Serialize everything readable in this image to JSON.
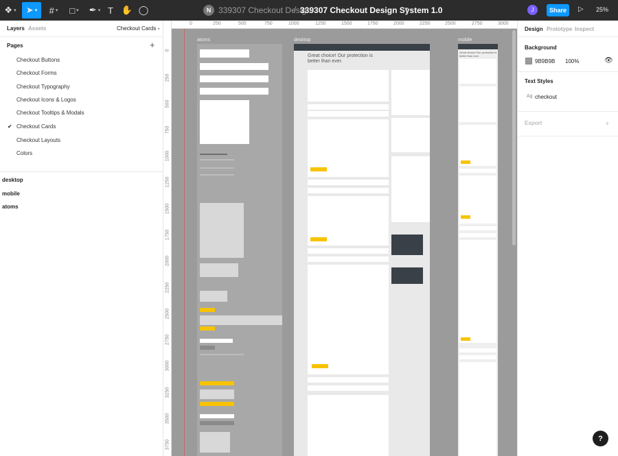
{
  "toolbar": {
    "file_avatar": "N",
    "file_name": "339307 Checkout Desig...",
    "separator": "/",
    "page_name": "339307 Checkout Design System 1.0",
    "user_initial": "J",
    "share_label": "Share",
    "zoom_label": "25%"
  },
  "left_panel": {
    "tabs": [
      "Layers",
      "Assets"
    ],
    "current_page": "Checkout Cards",
    "pages_heading": "Pages",
    "pages": [
      "Checkout Buttons",
      "Checkout Forms",
      "Checkout Typography",
      "Checkout Icons & Logos",
      "Checkout Tooltips & Modals",
      "Checkout Cards",
      "Checkout Layouts",
      "Colors"
    ],
    "selected_page_index": 5,
    "layers": [
      "desktop",
      "mobile",
      "atoms"
    ]
  },
  "canvas": {
    "ruler_x": [
      "0",
      "250",
      "500",
      "750",
      "1000",
      "1250",
      "1500",
      "1750",
      "2000",
      "2250",
      "2500",
      "2750",
      "3000"
    ],
    "ruler_y": [
      "0",
      "250",
      "500",
      "750",
      "1000",
      "1250",
      "1500",
      "1750",
      "2000",
      "2250",
      "2500",
      "2750",
      "3000",
      "3250",
      "3500",
      "3750"
    ],
    "frames": [
      "atoms",
      "desktop",
      "mobile"
    ],
    "desktop_hero": "Great choice! Our protection is better than ever.",
    "mobile_hero": "Great choice! Our protection is better than ever."
  },
  "right_panel": {
    "tabs": [
      "Design",
      "Prototype",
      "Inspect"
    ],
    "background_heading": "Background",
    "background_hex": "9B9B9B",
    "background_opacity": "100%",
    "background_color": "#9b9b9b",
    "text_styles_heading": "Text Styles",
    "text_style_name": "checkout",
    "export_heading": "Export"
  },
  "help_label": "?"
}
